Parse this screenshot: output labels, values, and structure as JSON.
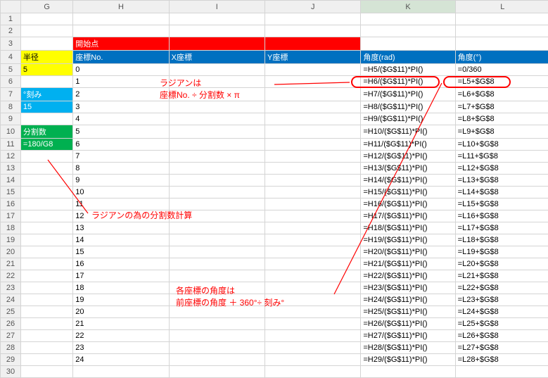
{
  "columns": [
    "",
    "G",
    "H",
    "I",
    "J",
    "K",
    "L"
  ],
  "selected_col": "K",
  "row_count": 30,
  "labels": {
    "start_point": "開始点",
    "coord_no": "座標No.",
    "x_coord": "X座標",
    "y_coord": "Y座標",
    "angle_rad": "角度(rad)",
    "angle_deg": "角度(°)",
    "radius": "半径",
    "radius_val": "5",
    "step": "°刻み",
    "step_val": "15",
    "div_count": "分割数",
    "div_val": "=180/G8"
  },
  "rows": [
    {
      "h": "0",
      "k": "=H5/($G$11)*PI()",
      "l": "=0/360"
    },
    {
      "h": "1",
      "k": "=H6/($G$11)*PI()",
      "l": "=L5+$G$8"
    },
    {
      "h": "2",
      "k": "=H7/($G$11)*PI()",
      "l": "=L6+$G$8"
    },
    {
      "h": "3",
      "k": "=H8/($G$11)*PI()",
      "l": "=L7+$G$8"
    },
    {
      "h": "4",
      "k": "=H9/($G$11)*PI()",
      "l": "=L8+$G$8"
    },
    {
      "h": "5",
      "k": "=H10/($G$11)*PI()",
      "l": "=L9+$G$8"
    },
    {
      "h": "6",
      "k": "=H11/($G$11)*PI()",
      "l": "=L10+$G$8"
    },
    {
      "h": "7",
      "k": "=H12/($G$11)*PI()",
      "l": "=L11+$G$8"
    },
    {
      "h": "8",
      "k": "=H13/($G$11)*PI()",
      "l": "=L12+$G$8"
    },
    {
      "h": "9",
      "k": "=H14/($G$11)*PI()",
      "l": "=L13+$G$8"
    },
    {
      "h": "10",
      "k": "=H15/($G$11)*PI()",
      "l": "=L14+$G$8"
    },
    {
      "h": "11",
      "k": "=H16/($G$11)*PI()",
      "l": "=L15+$G$8"
    },
    {
      "h": "12",
      "k": "=H17/($G$11)*PI()",
      "l": "=L16+$G$8"
    },
    {
      "h": "13",
      "k": "=H18/($G$11)*PI()",
      "l": "=L17+$G$8"
    },
    {
      "h": "14",
      "k": "=H19/($G$11)*PI()",
      "l": "=L18+$G$8"
    },
    {
      "h": "15",
      "k": "=H20/($G$11)*PI()",
      "l": "=L19+$G$8"
    },
    {
      "h": "16",
      "k": "=H21/($G$11)*PI()",
      "l": "=L20+$G$8"
    },
    {
      "h": "17",
      "k": "=H22/($G$11)*PI()",
      "l": "=L21+$G$8"
    },
    {
      "h": "18",
      "k": "=H23/($G$11)*PI()",
      "l": "=L22+$G$8"
    },
    {
      "h": "19",
      "k": "=H24/($G$11)*PI()",
      "l": "=L23+$G$8"
    },
    {
      "h": "20",
      "k": "=H25/($G$11)*PI()",
      "l": "=L24+$G$8"
    },
    {
      "h": "21",
      "k": "=H26/($G$11)*PI()",
      "l": "=L25+$G$8"
    },
    {
      "h": "22",
      "k": "=H27/($G$11)*PI()",
      "l": "=L26+$G$8"
    },
    {
      "h": "23",
      "k": "=H28/($G$11)*PI()",
      "l": "=L27+$G$8"
    },
    {
      "h": "24",
      "k": "=H29/($G$11)*PI()",
      "l": "=L28+$G$8"
    }
  ],
  "annotations": {
    "radian_note": "ラジアンは\n座標No. ÷ 分割数 × π",
    "div_note": "ラジアンの為の分割数計算",
    "angle_note": "各座標の角度は\n前座標の角度 ＋ 360°÷ 刻み°"
  }
}
